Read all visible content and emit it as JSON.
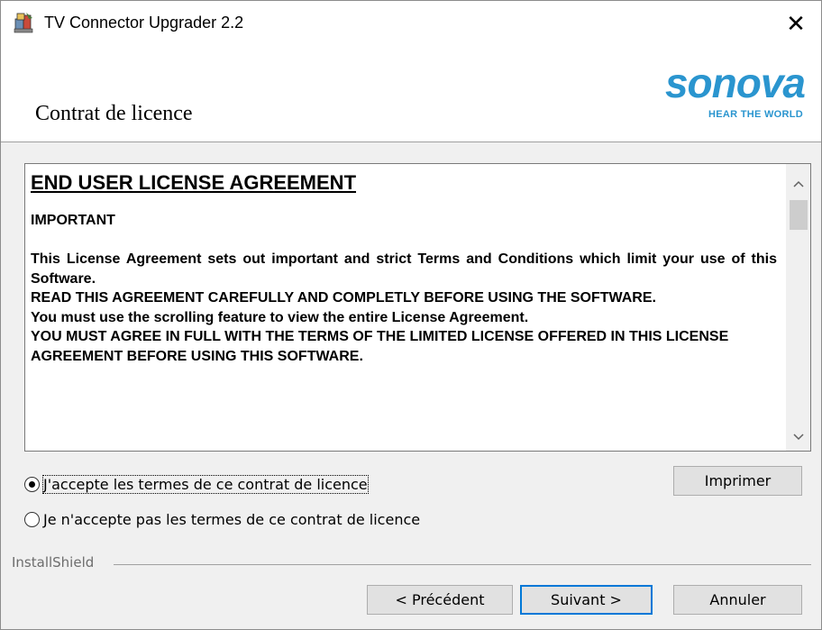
{
  "window": {
    "title": "TV Connector Upgrader 2.2",
    "close_glyph": "✕"
  },
  "header": {
    "title": "Contrat de licence",
    "logo_word": "sonova",
    "logo_tagline": "HEAR THE WORLD",
    "brand_color": "#2a95cf"
  },
  "license": {
    "heading": "END USER LICENSE AGREEMENT",
    "important": "IMPORTANT",
    "paragraph": "This License Agreement sets out important and strict Terms and Conditions which limit your use of this Software.",
    "line1": "READ THIS AGREEMENT CAREFULLY AND COMPLETLY BEFORE USING THE SOFTWARE.",
    "line2": "You must use the scrolling feature to view the entire License Agreement.",
    "line3": "YOU MUST AGREE IN FULL WITH THE TERMS OF THE LIMITED LICENSE OFFERED IN THIS LICENSE AGREEMENT BEFORE USING THIS SOFTWARE."
  },
  "options": {
    "accept_label": "J'accepte les termes de ce contrat de licence",
    "decline_label": "Je n'accepte pas les termes de ce contrat de licence",
    "selected": "accept"
  },
  "buttons": {
    "print": "Imprimer",
    "back": "< Précédent",
    "next": "Suivant >",
    "cancel": "Annuler"
  },
  "footer": {
    "installshield": "InstallShield"
  }
}
